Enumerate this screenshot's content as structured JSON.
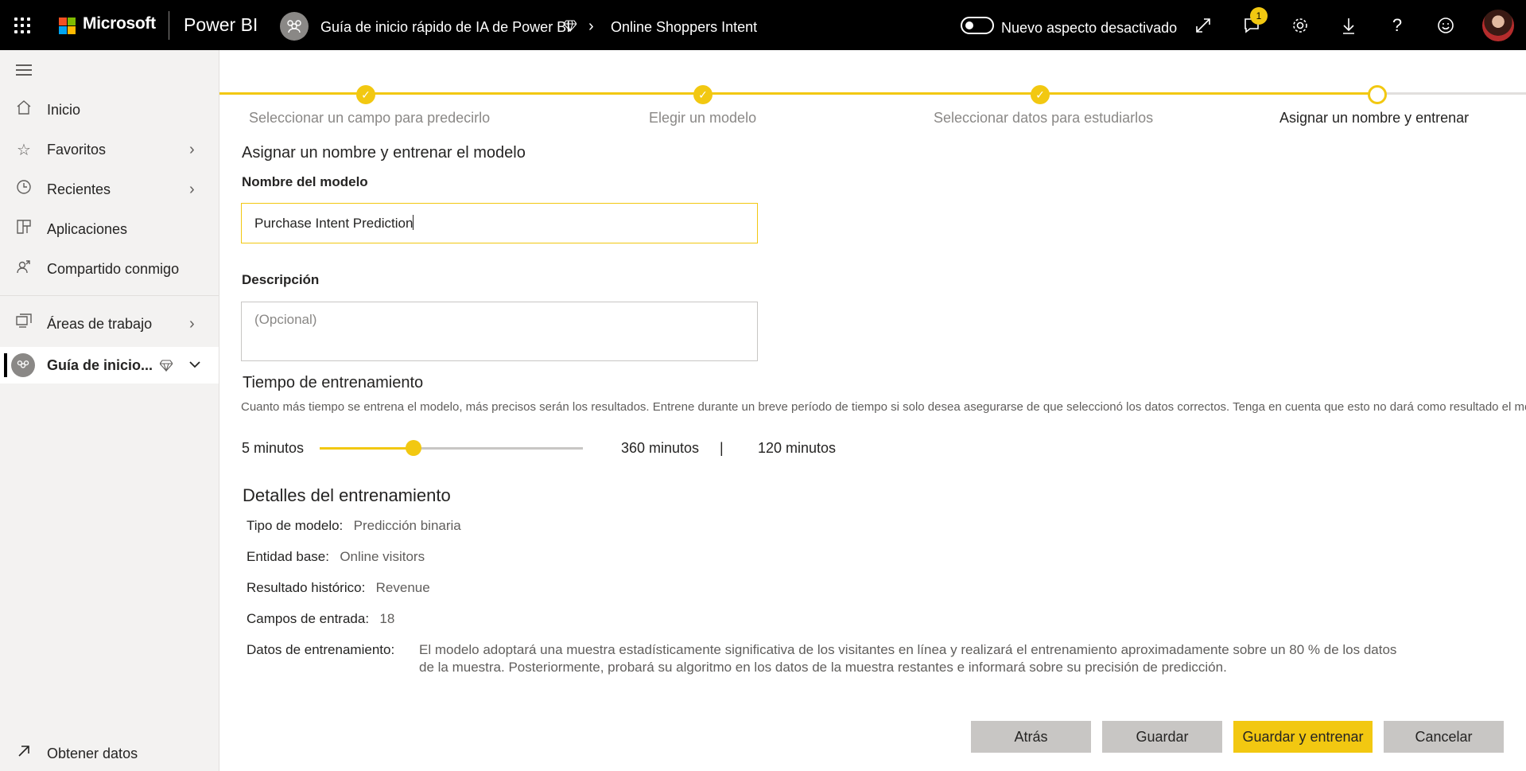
{
  "topbar": {
    "brand": "Microsoft",
    "app": "Power BI",
    "breadcrumb_workspace": "Guía de inicio rápido de IA de Power BI",
    "breadcrumb_item": "Online Shoppers Intent",
    "toggle_label": "Nuevo aspecto desactivado",
    "notification_count": "1",
    "icons": [
      "waffle-icon",
      "expand-icon",
      "notifications-icon",
      "settings-icon",
      "download-icon",
      "help-icon",
      "feedback-smiley-icon"
    ]
  },
  "sidebar": {
    "items": [
      {
        "label": "Inicio",
        "icon": "home-icon"
      },
      {
        "label": "Favoritos",
        "icon": "star-icon"
      },
      {
        "label": "Recientes",
        "icon": "clock-icon"
      },
      {
        "label": "Aplicaciones",
        "icon": "apps-icon"
      },
      {
        "label": "Compartido conmigo",
        "icon": "shared-icon"
      },
      {
        "label": "Áreas de trabajo",
        "icon": "workspaces-icon"
      },
      {
        "label": "Guía de inicio...",
        "icon": "workspace-avatar-icon"
      }
    ],
    "footer": "Obtener datos"
  },
  "steps": [
    {
      "label": "Seleccionar un campo para predecirlo",
      "status": "done"
    },
    {
      "label": "Elegir un modelo",
      "status": "done"
    },
    {
      "label": "Seleccionar datos para estudiarlos",
      "status": "done"
    },
    {
      "label": "Asignar un nombre y entrenar",
      "status": "current"
    }
  ],
  "form": {
    "title": "Asignar un nombre y entrenar el modelo",
    "name_label": "Nombre del modelo",
    "name_value": "Purchase Intent Prediction",
    "desc_label": "Descripción",
    "desc_placeholder": "(Opcional)"
  },
  "training": {
    "title": "Tiempo de entrenamiento",
    "help": "Cuanto más tiempo se entrena el modelo, más precisos serán los resultados. Entrene durante un breve período de tiempo si solo desea asegurarse de que seleccionó los datos correctos. Tenga en cuenta que esto no dará como resultado el mejor",
    "min_label": "5 minutos",
    "max_label": "360 minutos",
    "separator": "|",
    "current_label": "120 minutos",
    "slider_min": 5,
    "slider_max": 360,
    "slider_value": 120,
    "accent": "#f2c811"
  },
  "details": {
    "title": "Detalles del entrenamiento",
    "rows": [
      {
        "label": "Tipo de modelo:",
        "value": "Predicción binaria"
      },
      {
        "label": "Entidad base:",
        "value": "Online visitors"
      },
      {
        "label": "Resultado histórico:",
        "value": "Revenue"
      },
      {
        "label": "Campos de entrada:",
        "value": "18"
      }
    ],
    "training_data_label": "Datos de entrenamiento:",
    "training_data_line1": "El modelo adoptará una muestra estadísticamente significativa de los visitantes en línea y realizará el entrenamiento aproximadamente sobre un 80 % de los datos",
    "training_data_line2": "de la muestra. Posteriormente, probará su algoritmo en los datos de la muestra restantes e informará sobre su precisión de predicción."
  },
  "buttons": {
    "back": "Atrás",
    "save": "Guardar",
    "save_train": "Guardar y entrenar",
    "cancel": "Cancelar"
  },
  "colors": {
    "accent": "#f2c811",
    "topbar": "#000000",
    "sidebar": "#f3f2f1"
  }
}
